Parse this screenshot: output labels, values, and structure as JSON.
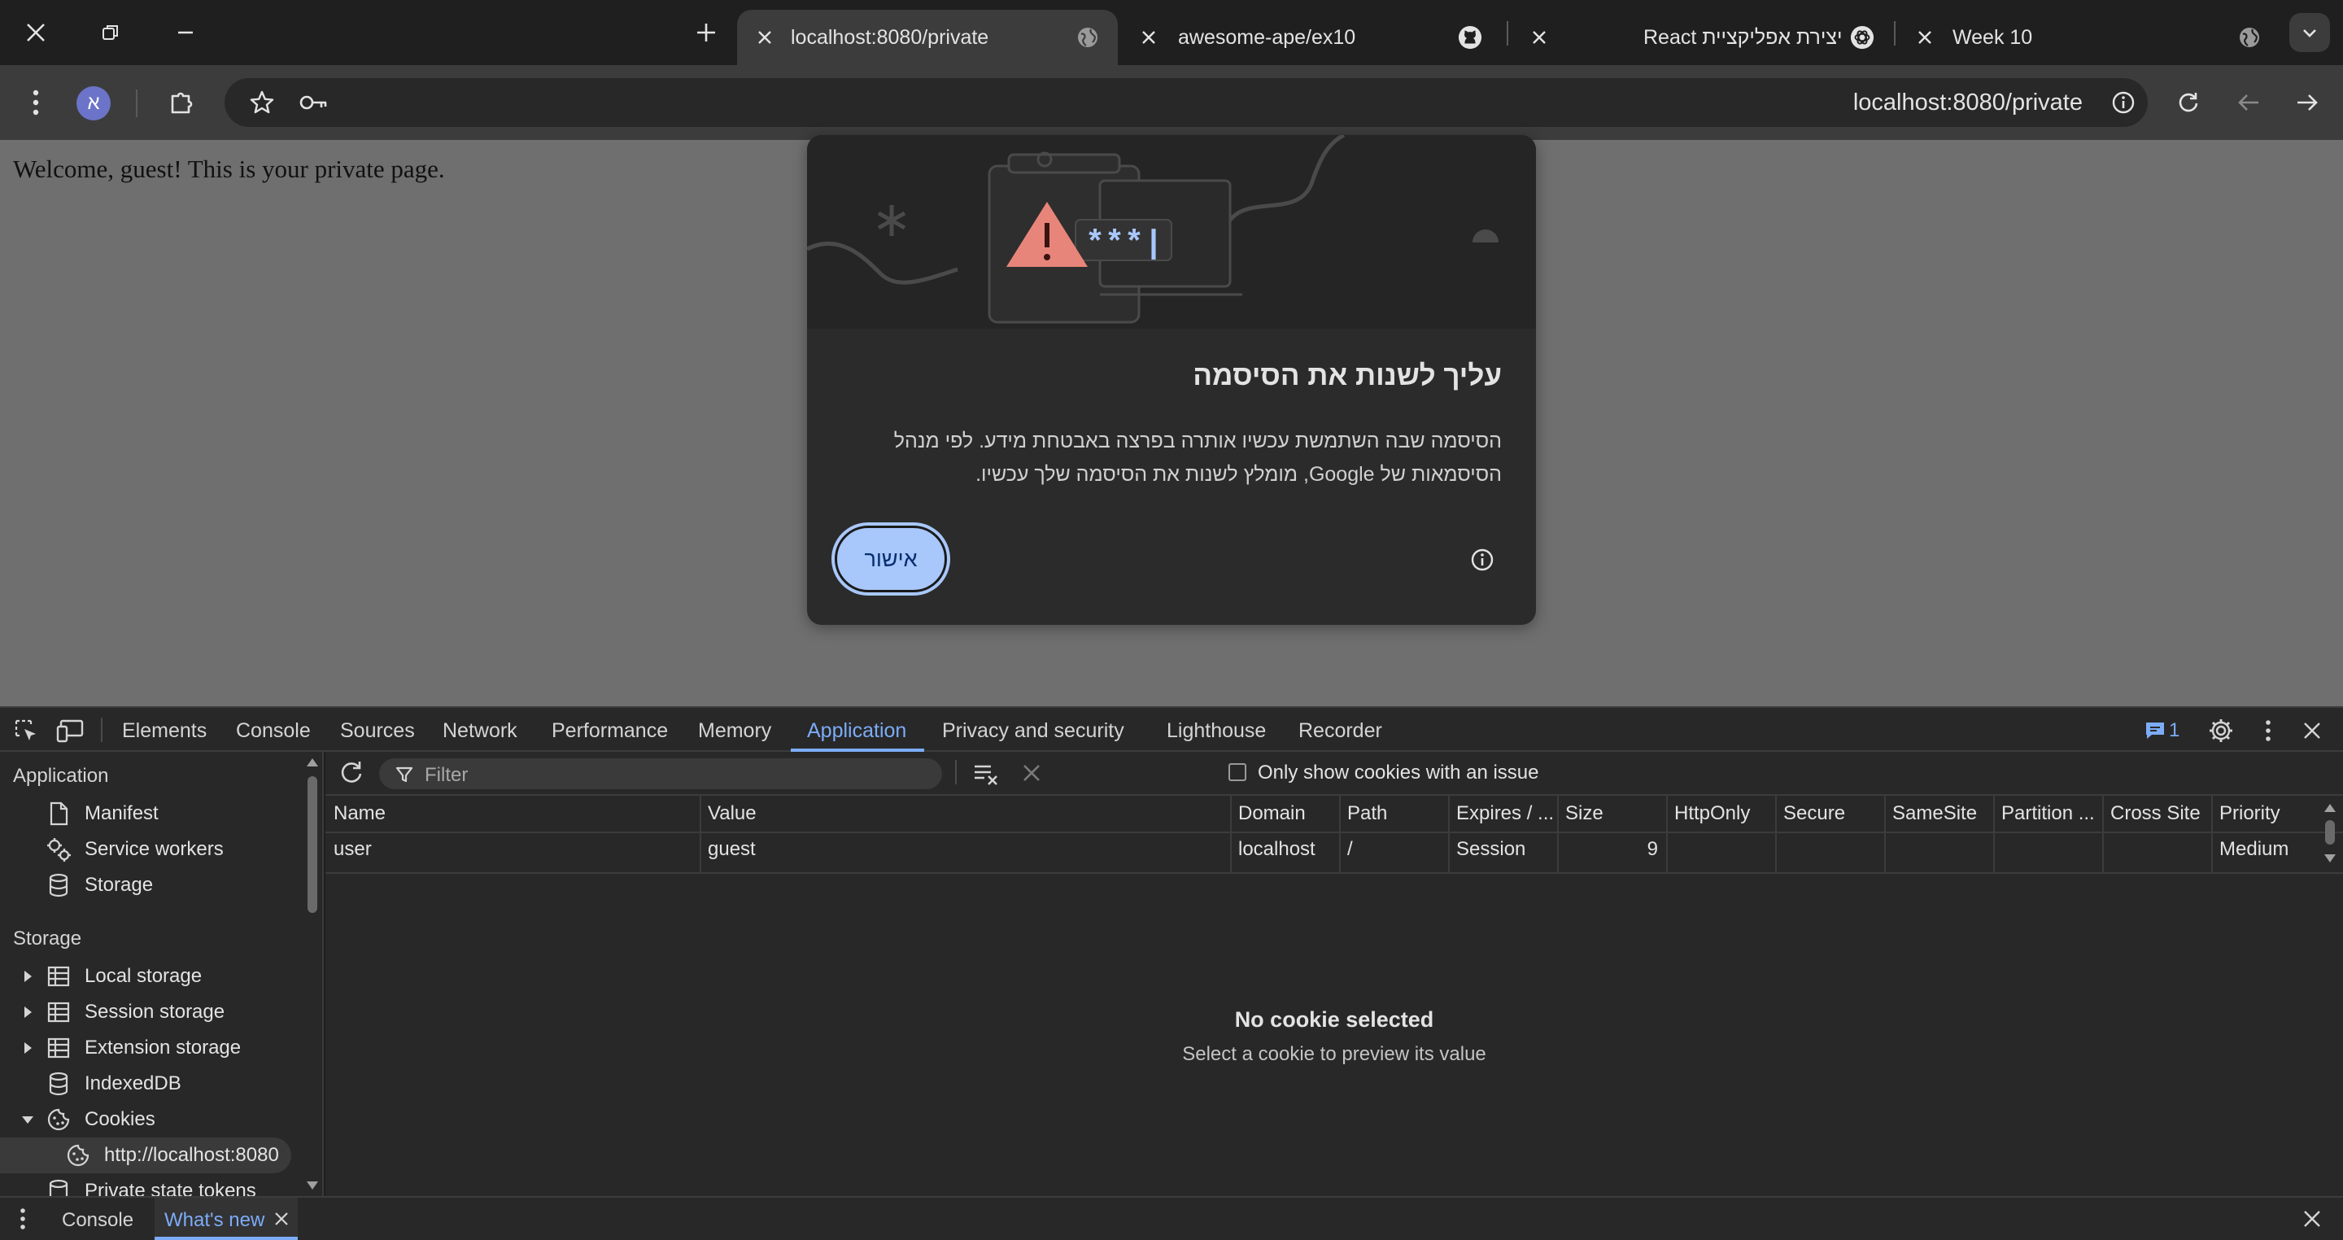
{
  "browser": {
    "tabs": [
      {
        "title": "localhost:8080/private",
        "active": true
      },
      {
        "title": "awesome-ape/ex10",
        "icon": "github-icon"
      },
      {
        "title": "יצירת אפליקציית React",
        "icon": "chatgpt-icon"
      },
      {
        "title": "Week 10",
        "icon": "globe-icon"
      }
    ],
    "profile_initial": "א",
    "url": "localhost:8080/private"
  },
  "page": {
    "welcome_text": "Welcome, guest! This is your private page."
  },
  "dialog": {
    "illustration_password": "***|",
    "title": "עליך לשנות את הסיסמה",
    "body_line1": "הסיסמה שבה השתמשת עכשיו אותרה בפרצה באבטחת מידע. לפי מנהל",
    "body_line2": "הסיסמאות של Google, מומלץ לשנות את הסיסמה שלך עכשיו.",
    "ok_label": "אישור"
  },
  "devtools": {
    "tabs": [
      "Elements",
      "Console",
      "Sources",
      "Network",
      "Performance",
      "Memory",
      "Application",
      "Privacy and security",
      "Lighthouse",
      "Recorder"
    ],
    "active_tab": "Application",
    "issues_count": "1",
    "sidebar": {
      "application_header": "Application",
      "application_items": [
        "Manifest",
        "Service workers",
        "Storage"
      ],
      "storage_header": "Storage",
      "storage_items": [
        "Local storage",
        "Session storage",
        "Extension storage",
        "IndexedDB",
        "Cookies",
        "http://localhost:8080",
        "Private state tokens"
      ]
    },
    "cookies": {
      "filter_placeholder": "Filter",
      "only_issue_label": "Only show cookies with an issue",
      "columns": [
        "Name",
        "Value",
        "Domain",
        "Path",
        "Expires / ...",
        "Size",
        "HttpOnly",
        "Secure",
        "SameSite",
        "Partition ...",
        "Cross Site",
        "Priority"
      ],
      "rows": [
        {
          "name": "user",
          "value": "guest",
          "domain": "localhost",
          "path": "/",
          "expires": "Session",
          "size": "9",
          "httponly": "",
          "secure": "",
          "samesite": "",
          "partition": "",
          "cross_site": "",
          "priority": "Medium"
        }
      ],
      "no_selection_title": "No cookie selected",
      "no_selection_sub": "Select a cookie to preview its value"
    },
    "drawer": {
      "tabs": [
        "Console",
        "What's new"
      ],
      "active_tab": "What's new"
    }
  },
  "colors": {
    "accent": "#7cacf8",
    "dialog_button": "#a8c7fa",
    "warning": "#e8857a"
  }
}
